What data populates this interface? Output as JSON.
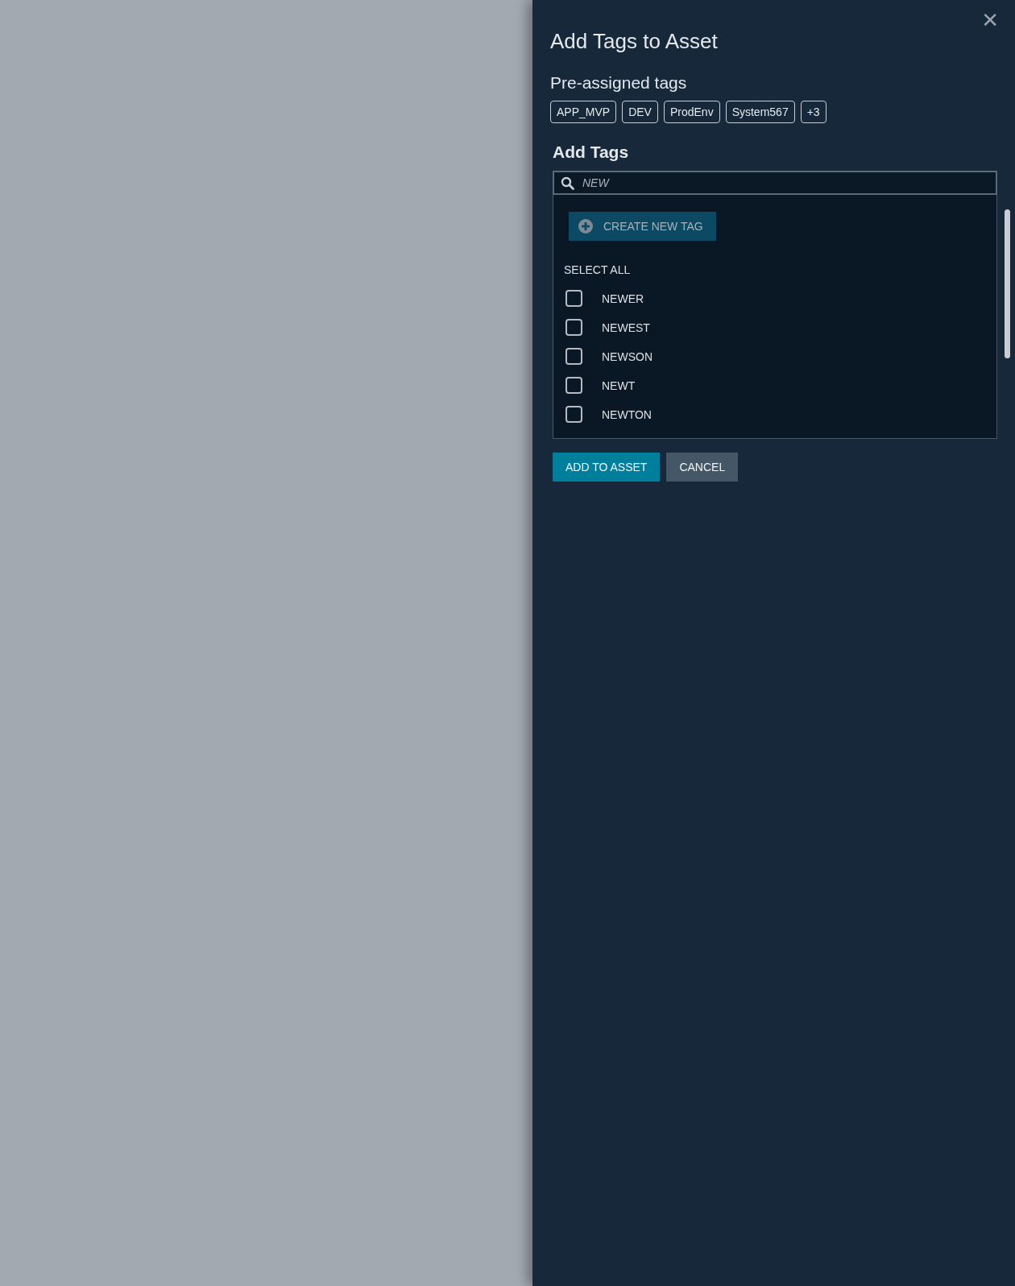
{
  "panel": {
    "title": "Add Tags to Asset",
    "close": "✕"
  },
  "preassigned": {
    "heading": "Pre-assigned tags",
    "tags": [
      "APP_MVP",
      "DEV",
      "ProdEnv",
      "System567",
      "+3"
    ]
  },
  "add_tags": {
    "heading": "Add Tags",
    "search": {
      "value": "NEW"
    },
    "create_button": "CREATE NEW TAG",
    "select_all": "SELECT ALL",
    "options": [
      {
        "label": "NEWER",
        "checked": false
      },
      {
        "label": "NEWEST",
        "checked": false
      },
      {
        "label": "NEWSON",
        "checked": false
      },
      {
        "label": "NEWT",
        "checked": false
      },
      {
        "label": "NEWTON",
        "checked": false
      }
    ]
  },
  "buttons": [
    {
      "label": "ADD TO ASSET",
      "kind": "primary"
    },
    {
      "label": "CANCEL",
      "kind": "secondary"
    }
  ]
}
